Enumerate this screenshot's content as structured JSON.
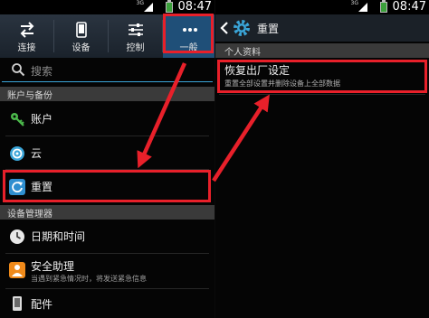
{
  "left_panel": {
    "status": {
      "network": "3G",
      "time": "08:47"
    },
    "tabs": [
      {
        "label": "连接",
        "icon": "arrows-swap-icon"
      },
      {
        "label": "设备",
        "icon": "phone-icon"
      },
      {
        "label": "控制",
        "icon": "sliders-icon"
      },
      {
        "label": "一般",
        "icon": "more-dots-icon"
      }
    ],
    "search": {
      "placeholder": "搜索"
    },
    "section_accounts": "账户与备份",
    "items_accounts": [
      {
        "label": "账户",
        "icon": "key-icon"
      },
      {
        "label": "云",
        "icon": "cloud-sync-icon"
      },
      {
        "label": "重置",
        "icon": "reset-icon"
      }
    ],
    "section_device": "设备管理器",
    "items_device": [
      {
        "label": "日期和时间",
        "icon": "clock-icon"
      },
      {
        "label": "安全助理",
        "sub": "当遇到紧急情况时，将发送紧急信息",
        "icon": "assist-icon"
      },
      {
        "label": "配件",
        "icon": "accessory-icon"
      }
    ]
  },
  "right_panel": {
    "status": {
      "network": "3G",
      "time": "08:47"
    },
    "header": {
      "title": "重置",
      "icon": "gear-icon"
    },
    "section": "个人资料",
    "item": {
      "label": "恢复出厂设定",
      "sub": "重置全部设置并删除设备上全部数据"
    }
  },
  "colors": {
    "highlight": "#e8202a",
    "accent": "#3aa5d8",
    "active_tab": "#1f4f78"
  }
}
